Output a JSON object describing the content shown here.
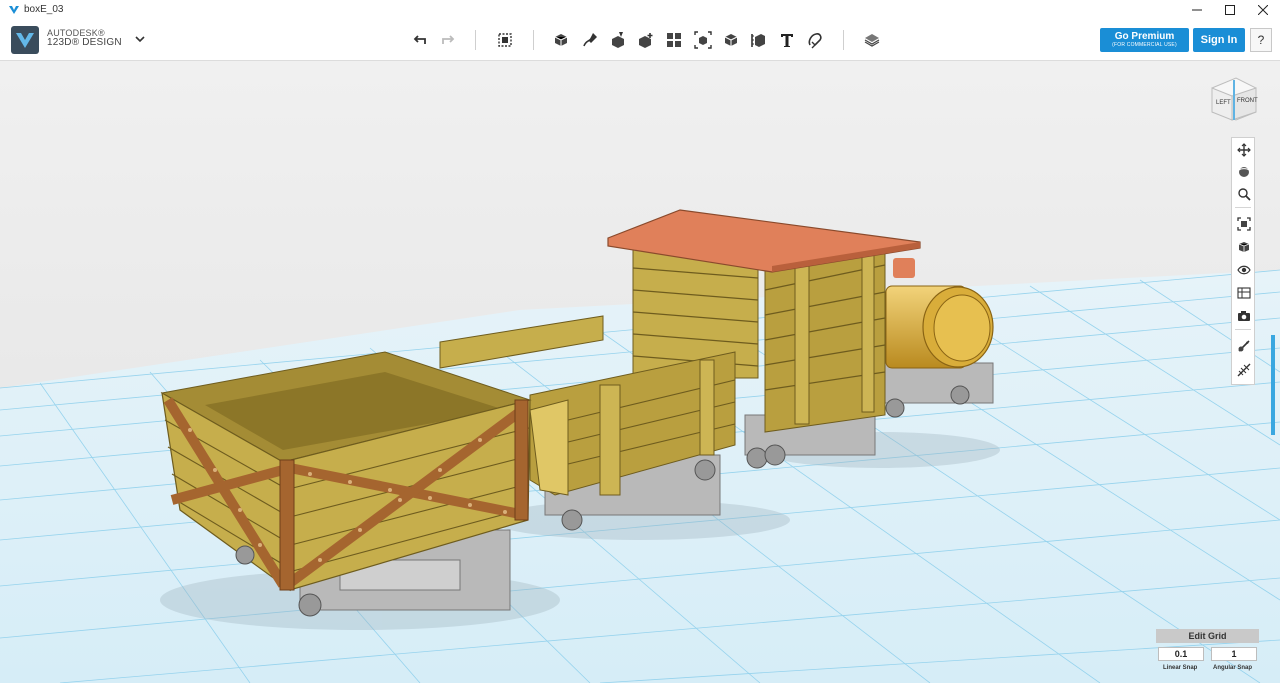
{
  "window": {
    "title": "boxE_03",
    "controls": [
      "minimize-icon",
      "maximize-icon",
      "close-icon"
    ]
  },
  "brand": {
    "line1": "AUTODESK®",
    "line2": "123D® DESIGN",
    "logo_icon": "autodesk-123d-logo"
  },
  "toolbar": {
    "tools": [
      {
        "name": "undo-icon"
      },
      {
        "name": "redo-icon"
      },
      {
        "name": "transform-icon"
      },
      {
        "name": "primitives-icon"
      },
      {
        "name": "sketch-icon"
      },
      {
        "name": "construct-icon"
      },
      {
        "name": "modify-icon"
      },
      {
        "name": "pattern-icon"
      },
      {
        "name": "group-icon"
      },
      {
        "name": "combine-icon"
      },
      {
        "name": "measure-icon"
      },
      {
        "name": "text-icon"
      },
      {
        "name": "snap-icon"
      },
      {
        "name": "material-icon"
      }
    ],
    "premium_label": "Go Premium",
    "premium_sub": "(FOR COMMERCIAL USE)",
    "signin_label": "Sign In",
    "help_label": "?"
  },
  "viewcube": {
    "left_label": "LEFT",
    "front_label": "FRONT"
  },
  "nav_tools": [
    "pan-icon",
    "orbit-icon",
    "zoom-icon",
    "fit-icon",
    "views-icon",
    "visibility-icon",
    "materials-outline-icon",
    "screenshot-icon",
    "snap-tool-icon",
    "edit-grid-tool-icon"
  ],
  "grid": {
    "edit_label": "Edit Grid",
    "linear_value": "0.1",
    "angular_value": "1",
    "linear_label": "Linear Snap",
    "angular_label": "Angular Snap"
  },
  "colors": {
    "accent": "#1a8ed6",
    "grid_line": "#6fc3e6",
    "wood": "#c6ae4c",
    "strap": "#a5652f",
    "roof": "#e0805a",
    "chassis": "#b4b4b4",
    "boiler": "#d9ad3a"
  }
}
